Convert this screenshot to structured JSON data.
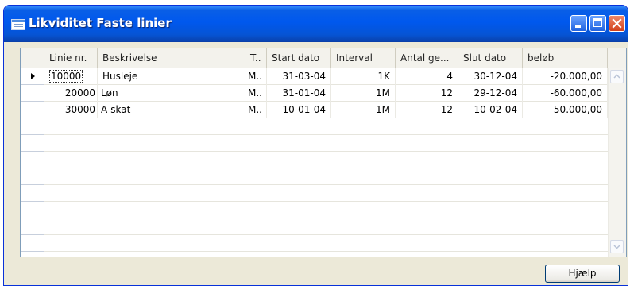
{
  "window": {
    "title": "Likviditet Faste linier",
    "icon": "table-window-icon",
    "controls": [
      "minimize-icon",
      "maximize-icon",
      "close-icon"
    ]
  },
  "table": {
    "columns": [
      "Linie nr.",
      "Beskrivelse",
      "T..",
      "Start dato",
      "Interval",
      "Antal ge...",
      "Slut dato",
      "beløb"
    ],
    "rows": [
      {
        "linie": "10000",
        "beskrivelse": "Husleje",
        "t": "M..",
        "start": "31-03-04",
        "interval": "1K",
        "antal": "4",
        "slut": "30-12-04",
        "belob": "-20.000,00"
      },
      {
        "linie": "20000",
        "beskrivelse": "Løn",
        "t": "M..",
        "start": "31-01-04",
        "interval": "1M",
        "antal": "12",
        "slut": "29-12-04",
        "belob": "-60.000,00"
      },
      {
        "linie": "30000",
        "beskrivelse": "A-skat",
        "t": "M..",
        "start": "10-01-04",
        "interval": "1M",
        "antal": "12",
        "slut": "10-02-04",
        "belob": "-50.000,00"
      }
    ],
    "empty_rows": 8,
    "selected_row": 0
  },
  "buttons": {
    "help": "Hjælp"
  },
  "colors": {
    "titlebar": "#0058ee",
    "window_bg": "#ece9d8",
    "close_button": "#d2401b"
  }
}
